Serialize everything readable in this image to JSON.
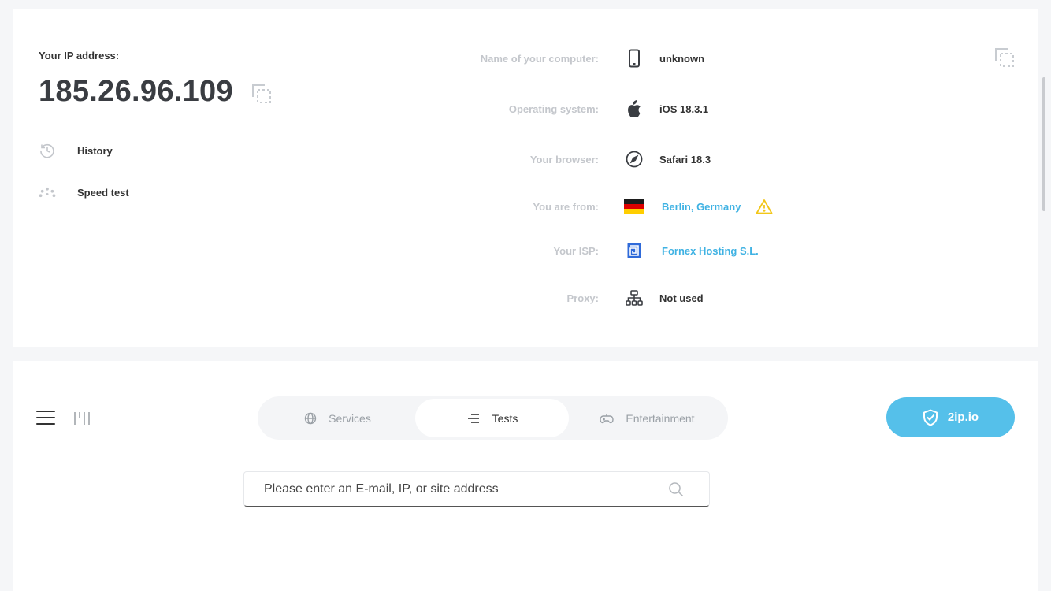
{
  "left": {
    "ip_label": "Your IP address:",
    "ip_value": "185.26.96.109",
    "links": [
      {
        "label": "History",
        "icon": "history-icon"
      },
      {
        "label": "Speed test",
        "icon": "speedometer-icon"
      }
    ]
  },
  "info": [
    {
      "label": "Name of your computer:",
      "value": "unknown",
      "icon": "phone-icon",
      "is_link": false
    },
    {
      "label": "Operating system:",
      "value": "iOS 18.3.1",
      "icon": "apple-icon",
      "is_link": false
    },
    {
      "label": "Your browser:",
      "value": "Safari 18.3",
      "icon": "compass-icon",
      "is_link": false
    },
    {
      "label": "You are from:",
      "value": "Berlin, Germany",
      "icon": "germany-flag-icon",
      "is_link": true
    },
    {
      "label": "Your ISP:",
      "value": "Fornex Hosting S.L.",
      "icon": "isp-logo-icon",
      "is_link": true
    },
    {
      "label": "Proxy:",
      "value": "Not used",
      "icon": "network-icon",
      "is_link": false
    }
  ],
  "nav": {
    "tabs": [
      {
        "label": "Services",
        "icon": "globe-icon",
        "active": false
      },
      {
        "label": "Tests",
        "icon": "lines-icon",
        "active": true
      },
      {
        "label": "Entertainment",
        "icon": "gamepad-icon",
        "active": false
      }
    ],
    "cta_label": "2ip.io"
  },
  "search": {
    "placeholder": "Please enter an E-mail, IP, or site address"
  },
  "colors": {
    "accent": "#55c0ea",
    "link": "#3fb2e3",
    "warning": "#f2c618"
  }
}
